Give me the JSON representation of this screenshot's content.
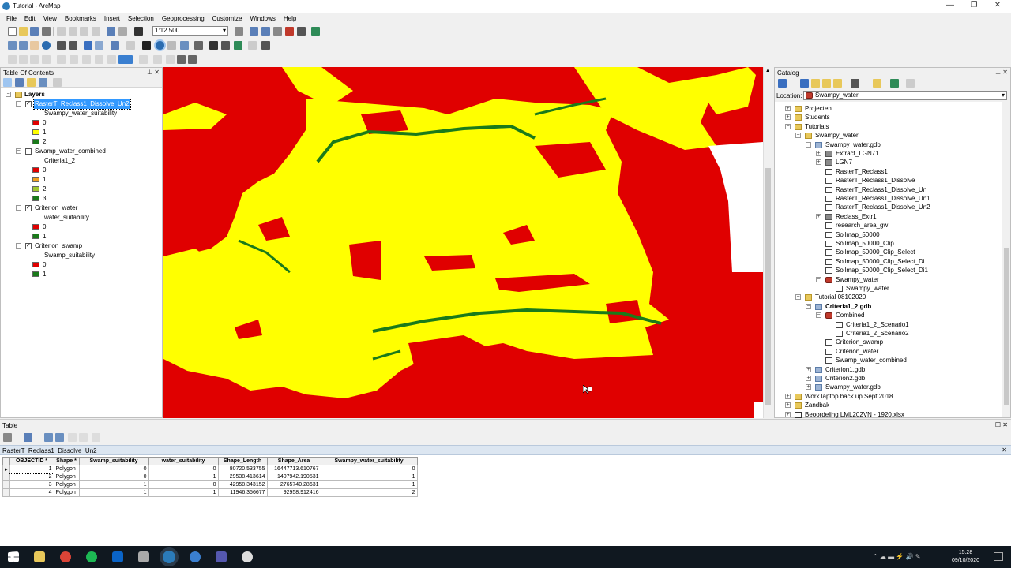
{
  "window": {
    "title": "Tutorial - ArcMap"
  },
  "menu": [
    "File",
    "Edit",
    "View",
    "Bookmarks",
    "Insert",
    "Selection",
    "Geoprocessing",
    "Customize",
    "Windows",
    "Help"
  ],
  "toolbar": {
    "scale": "1:12.500"
  },
  "toc": {
    "title": "Table Of Contents",
    "root": "Layers",
    "layers": [
      {
        "name": "RasterT_Reclass1_Dissolve_Un2",
        "field": "Swampy_water_suitability",
        "checked": true,
        "selected": true,
        "classes": [
          {
            "label": "0",
            "color": "#e00000"
          },
          {
            "label": "1",
            "color": "#ffff00"
          },
          {
            "label": "2",
            "color": "#1a7a1a"
          }
        ]
      },
      {
        "name": "Swamp_water_combined",
        "field": "Criteria1_2",
        "checked": false,
        "selected": false,
        "classes": [
          {
            "label": "0",
            "color": "#e00000"
          },
          {
            "label": "1",
            "color": "#f0a020"
          },
          {
            "label": "2",
            "color": "#a0c830"
          },
          {
            "label": "3",
            "color": "#1a7a1a"
          }
        ]
      },
      {
        "name": "Criterion_water",
        "field": "water_suitability",
        "checked": true,
        "selected": false,
        "classes": [
          {
            "label": "0",
            "color": "#e00000"
          },
          {
            "label": "1",
            "color": "#1a7a1a"
          }
        ]
      },
      {
        "name": "Criterion_swamp",
        "field": "Swamp_suitability",
        "checked": true,
        "selected": false,
        "classes": [
          {
            "label": "0",
            "color": "#e00000"
          },
          {
            "label": "1",
            "color": "#1a7a1a"
          }
        ]
      }
    ]
  },
  "catalog": {
    "title": "Catalog",
    "location_label": "Location:",
    "location_value": "Swampy_water",
    "items": [
      {
        "label": "Projecten",
        "indent": 0,
        "icon": "folder",
        "exp": "+"
      },
      {
        "label": "Students",
        "indent": 0,
        "icon": "folder",
        "exp": "+"
      },
      {
        "label": "Tutorials",
        "indent": 0,
        "icon": "folder",
        "exp": "-"
      },
      {
        "label": "Swampy_water",
        "indent": 1,
        "icon": "folder",
        "exp": "-"
      },
      {
        "label": "Swampy_water.gdb",
        "indent": 2,
        "icon": "gdb",
        "exp": "-"
      },
      {
        "label": "Extract_LGN71",
        "indent": 3,
        "icon": "raster",
        "exp": "+"
      },
      {
        "label": "LGN7",
        "indent": 3,
        "icon": "raster",
        "exp": "+"
      },
      {
        "label": "RasterT_Reclass1",
        "indent": 3,
        "icon": "fc",
        "exp": ""
      },
      {
        "label": "RasterT_Reclass1_Dissolve",
        "indent": 3,
        "icon": "fc",
        "exp": ""
      },
      {
        "label": "RasterT_Reclass1_Dissolve_Un",
        "indent": 3,
        "icon": "fc",
        "exp": ""
      },
      {
        "label": "RasterT_Reclass1_Dissolve_Un1",
        "indent": 3,
        "icon": "fc",
        "exp": ""
      },
      {
        "label": "RasterT_Reclass1_Dissolve_Un2",
        "indent": 3,
        "icon": "fc",
        "exp": ""
      },
      {
        "label": "Reclass_Extr1",
        "indent": 3,
        "icon": "raster",
        "exp": "+"
      },
      {
        "label": "research_area_gw",
        "indent": 3,
        "icon": "fc",
        "exp": ""
      },
      {
        "label": "Soilmap_50000",
        "indent": 3,
        "icon": "fc",
        "exp": ""
      },
      {
        "label": "Soilmap_50000_Clip",
        "indent": 3,
        "icon": "fc",
        "exp": ""
      },
      {
        "label": "Soilmap_50000_Clip_Select",
        "indent": 3,
        "icon": "fc",
        "exp": ""
      },
      {
        "label": "Soilmap_50000_Clip_Select_Di",
        "indent": 3,
        "icon": "fc",
        "exp": ""
      },
      {
        "label": "Soilmap_50000_Clip_Select_Di1",
        "indent": 3,
        "icon": "fc",
        "exp": ""
      },
      {
        "label": "Swampy_water",
        "indent": 3,
        "icon": "fd",
        "exp": "-"
      },
      {
        "label": "Swampy_water",
        "indent": 4,
        "icon": "fc",
        "exp": ""
      },
      {
        "label": "Tutorial 08102020",
        "indent": 1,
        "icon": "folder",
        "exp": "-"
      },
      {
        "label": "Criteria1_2.gdb",
        "indent": 2,
        "icon": "gdb",
        "exp": "-",
        "bold": true
      },
      {
        "label": "Combined",
        "indent": 3,
        "icon": "fd",
        "exp": "-"
      },
      {
        "label": "Criteria1_2_Scenario1",
        "indent": 4,
        "icon": "fc",
        "exp": ""
      },
      {
        "label": "Criteria1_2_Scenario2",
        "indent": 4,
        "icon": "fc",
        "exp": ""
      },
      {
        "label": "Criterion_swamp",
        "indent": 3,
        "icon": "fc",
        "exp": ""
      },
      {
        "label": "Criterion_water",
        "indent": 3,
        "icon": "fc",
        "exp": ""
      },
      {
        "label": "Swamp_water_combined",
        "indent": 3,
        "icon": "fc",
        "exp": ""
      },
      {
        "label": "Criterion1.gdb",
        "indent": 2,
        "icon": "gdb",
        "exp": "+"
      },
      {
        "label": "Criterion2.gdb",
        "indent": 2,
        "icon": "gdb",
        "exp": "+"
      },
      {
        "label": "Swampy_water.gdb",
        "indent": 2,
        "icon": "gdb",
        "exp": "+"
      },
      {
        "label": "Work laptop back up Sept 2018",
        "indent": 0,
        "icon": "folder",
        "exp": "+"
      },
      {
        "label": "Zandbak",
        "indent": 0,
        "icon": "folder",
        "exp": "+"
      },
      {
        "label": "Beoordeling LML202VN - 1920.xlsx",
        "indent": 0,
        "icon": "xls",
        "exp": "+"
      }
    ]
  },
  "table": {
    "title": "Table",
    "tab": "RasterT_Reclass1_Dissolve_Un2",
    "columns": [
      "OBJECTID *",
      "Shape *",
      "Swamp_suitability",
      "water_suitability",
      "Shape_Length",
      "Shape_Area",
      "Swampy_water_suitability"
    ],
    "rows": [
      [
        "1",
        "Polygon",
        "0",
        "0",
        "80720.533755",
        "16447713.610767",
        "0"
      ],
      [
        "2",
        "Polygon",
        "0",
        "1",
        "29538.413614",
        "1407942.190531",
        "1"
      ],
      [
        "3",
        "Polygon",
        "1",
        "0",
        "42958.343152",
        "2765740.28631",
        "1"
      ],
      [
        "4",
        "Polygon",
        "1",
        "1",
        "11946.356677",
        "92958.912416",
        "2"
      ]
    ]
  },
  "taskbar": {
    "time": "15:28",
    "date": "09/10/2020"
  },
  "colors": {
    "red": "#e00000",
    "yellow": "#ffff00",
    "green": "#1a7a1a",
    "selection": "#3399ff"
  }
}
